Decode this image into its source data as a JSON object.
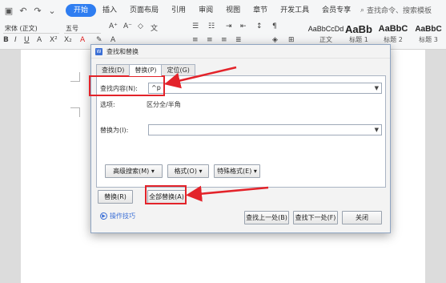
{
  "menubar": {
    "tabs": [
      "开始",
      "插入",
      "页面布局",
      "引用",
      "审阅",
      "视图",
      "章节",
      "开发工具",
      "会员专享"
    ],
    "search_label": "查找命令、搜索模板"
  },
  "toolbar": {
    "font_name": "宋体 (正文)",
    "font_size": "五号",
    "styles": [
      {
        "preview": "AaBbCcDd",
        "name": "正文"
      },
      {
        "preview": "AaBb",
        "name": "标题 1"
      },
      {
        "preview": "AaBbC",
        "name": "标题 2"
      },
      {
        "preview": "AaBbC",
        "name": "标题 3"
      }
    ]
  },
  "dialog": {
    "title": "查找和替换",
    "tabs": [
      "查找(D)",
      "替换(P)",
      "定位(G)"
    ],
    "find_label": "查找内容(N):",
    "find_value": "^p",
    "options_label": "选项:",
    "options_value": "区分全/半角",
    "replace_label": "替换为(I):",
    "replace_value": "",
    "advanced_button": "高级搜索(M) ▾",
    "format_button": "格式(O) ▾",
    "special_button": "特殊格式(E) ▾",
    "replace_button": "替换(R)",
    "replace_all_button": "全部替换(A)",
    "tips_link": "操作技巧",
    "find_prev_button": "查找上一处(B)",
    "find_next_button": "查找下一处(F)",
    "close_button": "关闭"
  },
  "colors": {
    "accent": "#2e7df1",
    "highlight": "#e3232a"
  }
}
